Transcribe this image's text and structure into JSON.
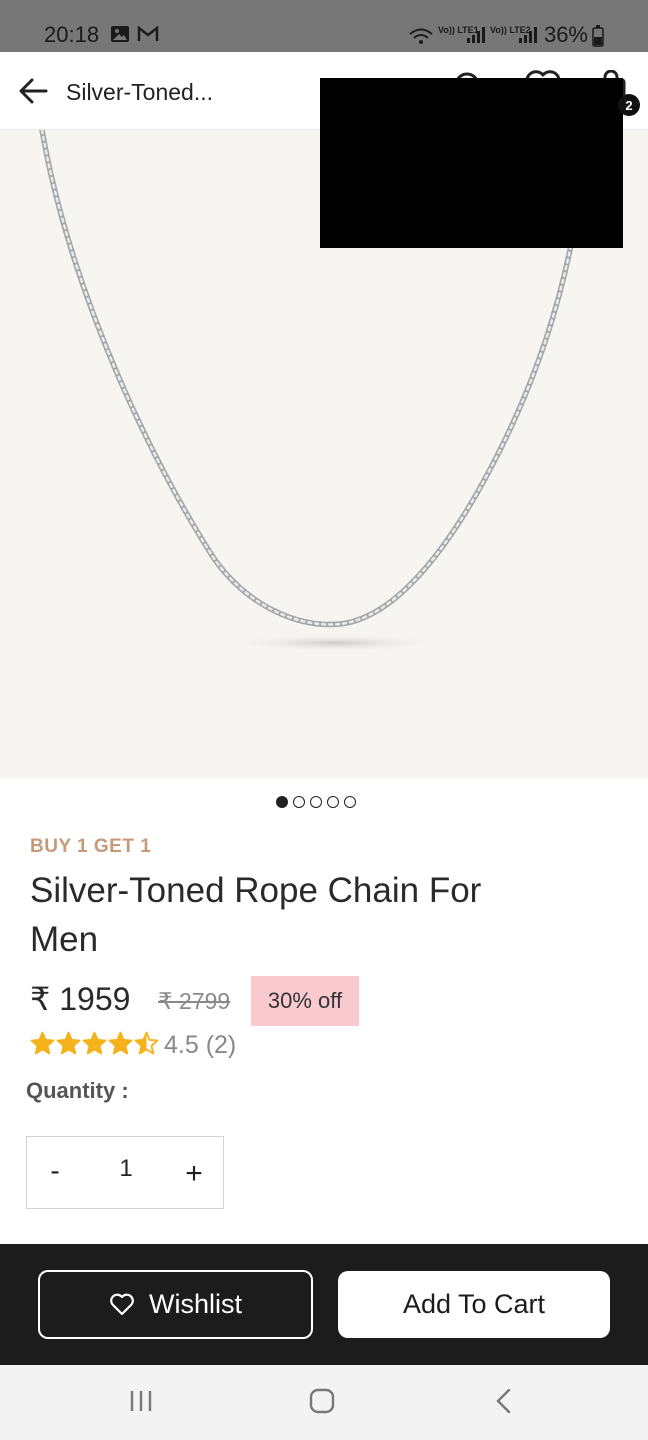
{
  "status_bar": {
    "time": "20:18",
    "sim1_label": "Vo)) LTE1",
    "sim2_label": "Vo)) LTE2",
    "battery": "36%",
    "icons": [
      "gallery-icon",
      "gmail-icon",
      "wifi-icon",
      "signal-icon",
      "battery-icon"
    ]
  },
  "header": {
    "title": "Silver-Toned...",
    "cart_count": "2",
    "icons": [
      "back-arrow-icon",
      "search-icon",
      "heart-icon",
      "bag-icon"
    ]
  },
  "gallery": {
    "image_count": 5,
    "active_index": 0,
    "background": "#f7f5f2"
  },
  "product": {
    "promo": "BUY 1 GET 1",
    "title": "Silver-Toned Rope Chain For Men",
    "price": "₹ 1959",
    "mrp": "₹ 2799",
    "discount": "30% off",
    "rating_stars": 4.5,
    "rating_text": "4.5 (2)"
  },
  "quantity": {
    "label": "Quantity :",
    "minus": "-",
    "value": "1",
    "plus": "+"
  },
  "actions": {
    "wishlist": "Wishlist",
    "add_to_cart": "Add To Cart"
  },
  "colors": {
    "promo": "#c49a7a",
    "discount_bg": "#f8c9cf",
    "star": "#f5b21b",
    "action_bar": "#1c1c1c"
  }
}
